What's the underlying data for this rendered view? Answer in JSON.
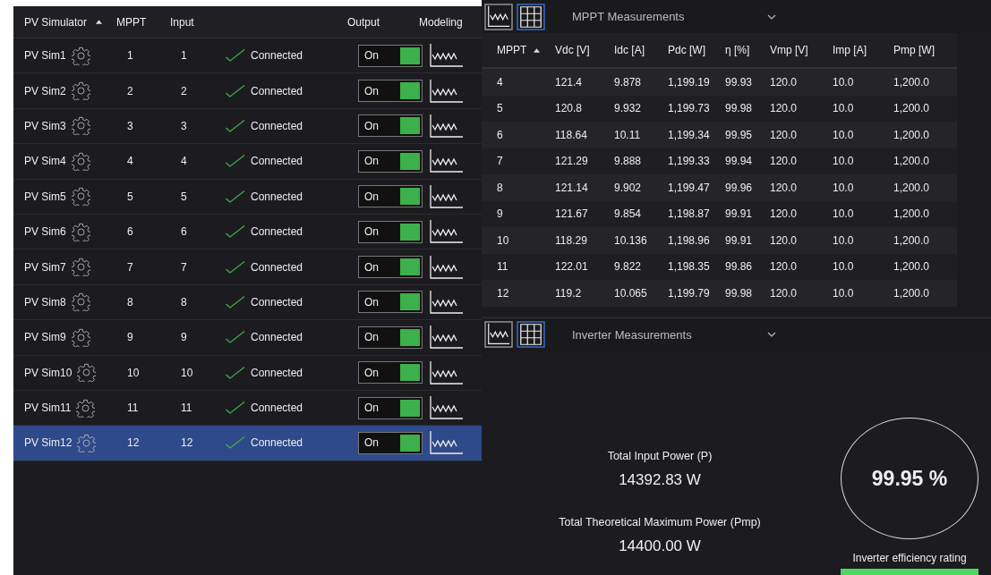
{
  "simulators": {
    "columns": [
      {
        "label": "PV Simulator",
        "sorted": true
      },
      {
        "label": "MPPT",
        "sorted": false
      },
      {
        "label": "Input",
        "sorted": false
      },
      {
        "label": "Output",
        "sorted": false
      },
      {
        "label": "Modeling",
        "sorted": false
      }
    ],
    "rows": [
      {
        "name": "PV Sim1",
        "mppt": "1",
        "input": "1",
        "status": "Connected",
        "output": "On",
        "on": true,
        "selected": false
      },
      {
        "name": "PV Sim2",
        "mppt": "2",
        "input": "2",
        "status": "Connected",
        "output": "On",
        "on": true,
        "selected": false
      },
      {
        "name": "PV Sim3",
        "mppt": "3",
        "input": "3",
        "status": "Connected",
        "output": "On",
        "on": true,
        "selected": false
      },
      {
        "name": "PV Sim4",
        "mppt": "4",
        "input": "4",
        "status": "Connected",
        "output": "On",
        "on": true,
        "selected": false
      },
      {
        "name": "PV Sim5",
        "mppt": "5",
        "input": "5",
        "status": "Connected",
        "output": "On",
        "on": true,
        "selected": false
      },
      {
        "name": "PV Sim6",
        "mppt": "6",
        "input": "6",
        "status": "Connected",
        "output": "On",
        "on": true,
        "selected": false
      },
      {
        "name": "PV Sim7",
        "mppt": "7",
        "input": "7",
        "status": "Connected",
        "output": "On",
        "on": true,
        "selected": false
      },
      {
        "name": "PV Sim8",
        "mppt": "8",
        "input": "8",
        "status": "Connected",
        "output": "On",
        "on": true,
        "selected": false
      },
      {
        "name": "PV Sim9",
        "mppt": "9",
        "input": "9",
        "status": "Connected",
        "output": "On",
        "on": true,
        "selected": false
      },
      {
        "name": "PV Sim10",
        "mppt": "10",
        "input": "10",
        "status": "Connected",
        "output": "On",
        "on": true,
        "selected": false
      },
      {
        "name": "PV Sim11",
        "mppt": "11",
        "input": "11",
        "status": "Connected",
        "output": "On",
        "on": true,
        "selected": false
      },
      {
        "name": "PV Sim12",
        "mppt": "12",
        "input": "12",
        "status": "Connected",
        "output": "On",
        "on": true,
        "selected": true
      }
    ]
  },
  "mppt_panel": {
    "title": "MPPT Measurements",
    "views": [
      {
        "kind": "chart",
        "selected": false
      },
      {
        "kind": "table",
        "selected": true
      }
    ],
    "columns": [
      {
        "label": "MPPT",
        "sorted": true
      },
      {
        "label": "Vdc [V]",
        "sorted": false
      },
      {
        "label": "Idc [A]",
        "sorted": false
      },
      {
        "label": "Pdc [W]",
        "sorted": false
      },
      {
        "label": "η [%]",
        "sorted": false
      },
      {
        "label": "Vmp [V]",
        "sorted": false
      },
      {
        "label": "Imp [A]",
        "sorted": false
      },
      {
        "label": "Pmp [W]",
        "sorted": false
      }
    ],
    "rows": [
      [
        "4",
        "121.4",
        "9.878",
        "1,199.19",
        "99.93",
        "120.0",
        "10.0",
        "1,200.0"
      ],
      [
        "5",
        "120.8",
        "9.932",
        "1,199.73",
        "99.98",
        "120.0",
        "10.0",
        "1,200.0"
      ],
      [
        "6",
        "118.64",
        "10.11",
        "1,199.34",
        "99.95",
        "120.0",
        "10.0",
        "1,200.0"
      ],
      [
        "7",
        "121.29",
        "9.888",
        "1,199.33",
        "99.94",
        "120.0",
        "10.0",
        "1,200.0"
      ],
      [
        "8",
        "121.14",
        "9.902",
        "1,199.47",
        "99.96",
        "120.0",
        "10.0",
        "1,200.0"
      ],
      [
        "9",
        "121.67",
        "9.854",
        "1,198.87",
        "99.91",
        "120.0",
        "10.0",
        "1,200.0"
      ],
      [
        "10",
        "118.29",
        "10.136",
        "1,198.96",
        "99.91",
        "120.0",
        "10.0",
        "1,200.0"
      ],
      [
        "11",
        "122.01",
        "9.822",
        "1,198.35",
        "99.86",
        "120.0",
        "10.0",
        "1,200.0"
      ],
      [
        "12",
        "119.2",
        "10.065",
        "1,199.79",
        "99.98",
        "120.0",
        "10.0",
        "1,200.0"
      ]
    ]
  },
  "inverter_panel": {
    "title": "Inverter Measurements",
    "views": [
      {
        "kind": "chart",
        "selected": false
      },
      {
        "kind": "table",
        "selected": true
      }
    ],
    "total_input_label": "Total Input Power (P)",
    "total_input_value": "14392.83 W",
    "total_max_label": "Total Theoretical Maximum Power (Pmp)",
    "total_max_value": "14400.00 W",
    "efficiency": "99.95 %",
    "efficiency_label": "Inverter efficiency rating"
  }
}
